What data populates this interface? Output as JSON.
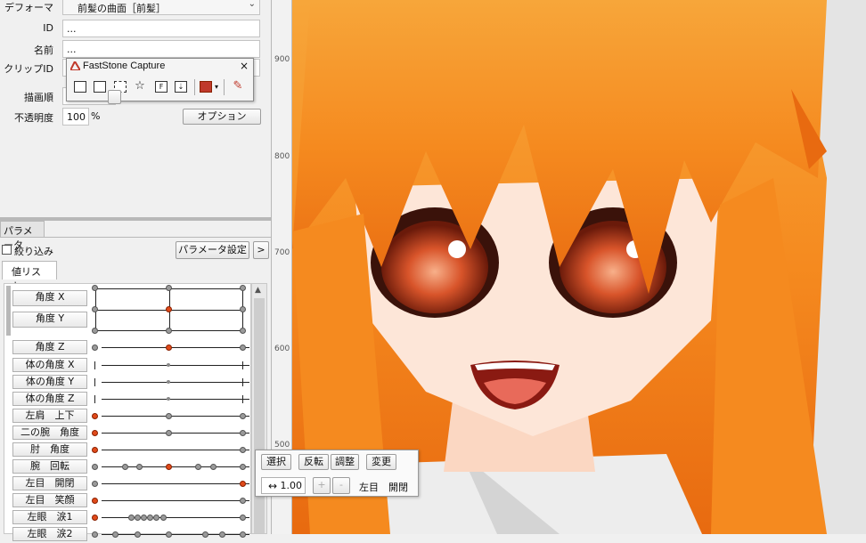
{
  "props": {
    "deformer_label": "デフォーマ",
    "deformer_value": "前髪の曲面［前髪］",
    "id_label": "ID",
    "id_value": "...",
    "name_label": "名前",
    "name_value": "...",
    "clip_label": "クリップID",
    "draw_order_label": "描画順",
    "opacity_label": "不透明度",
    "opacity_value": "100",
    "opacity_unit": "%",
    "option_button": "オプション"
  },
  "faststone": {
    "title": "FastStone Capture",
    "close": "×",
    "icons": [
      "window-capture-icon",
      "object-capture-icon",
      "rect-capture-icon",
      "freehand-capture-icon",
      "fullscreen-capture-icon",
      "scroll-capture-icon",
      "save-icon",
      "settings-icon"
    ]
  },
  "param_panel": {
    "title": "パラメータ",
    "filter_label": "絞り込み",
    "settings_button": "パラメータ設定",
    "arrow_button": ">",
    "tab_values": "値リスト"
  },
  "params": [
    {
      "label": "角度 X"
    },
    {
      "label": "角度 Y"
    },
    {
      "label": "角度 Z"
    },
    {
      "label": "体の角度 X"
    },
    {
      "label": "体の角度 Y"
    },
    {
      "label": "体の角度 Z"
    },
    {
      "label": "左肩　上下"
    },
    {
      "label": "二の腕　角度"
    },
    {
      "label": "肘　角度"
    },
    {
      "label": "腕　回転"
    },
    {
      "label": "左目　開閉"
    },
    {
      "label": "左目　笑顔"
    },
    {
      "label": "左眼　涙1"
    },
    {
      "label": "左眼　涙2"
    }
  ],
  "ruler_ticks": [
    "900",
    "800",
    "700",
    "600",
    "500"
  ],
  "popup": {
    "select": "選択",
    "invert": "反転",
    "adjust": "調整",
    "change": "変更",
    "value": "1.00",
    "plus": "+",
    "minus": "-",
    "param_name": "左目　開閉"
  },
  "colors": {
    "hair": "#f58a1f",
    "skin": "#fde6d8",
    "accent": "#e04a1a"
  }
}
